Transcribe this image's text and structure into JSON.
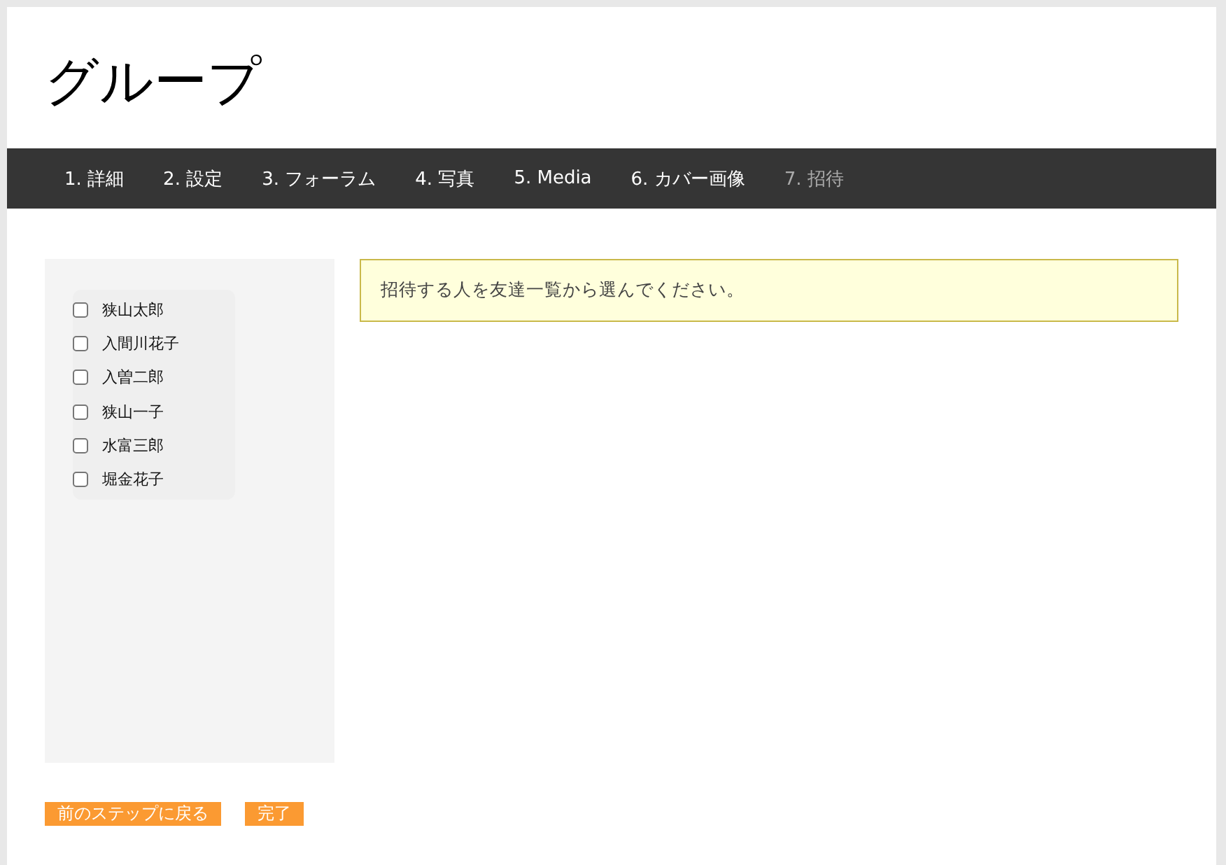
{
  "title": "グループ",
  "steps": [
    {
      "label": "1. 詳細",
      "selected": false
    },
    {
      "label": "2. 設定",
      "selected": false
    },
    {
      "label": "3. フォーラム",
      "selected": false
    },
    {
      "label": "4. 写真",
      "selected": false
    },
    {
      "label": "5. Media",
      "selected": false
    },
    {
      "label": "6. カバー画像",
      "selected": false
    },
    {
      "label": "7. 招待",
      "selected": true
    }
  ],
  "friends": [
    {
      "name": "狭山太郎",
      "checked": false
    },
    {
      "name": "入間川花子",
      "checked": false
    },
    {
      "name": "入曽二郎",
      "checked": false
    },
    {
      "name": "狭山一子",
      "checked": false
    },
    {
      "name": "水富三郎",
      "checked": false
    },
    {
      "name": "堀金花子",
      "checked": false
    }
  ],
  "message": "招待する人を友達一覧から選んでください。",
  "buttons": [
    "前のステップに戻る",
    "完了"
  ]
}
